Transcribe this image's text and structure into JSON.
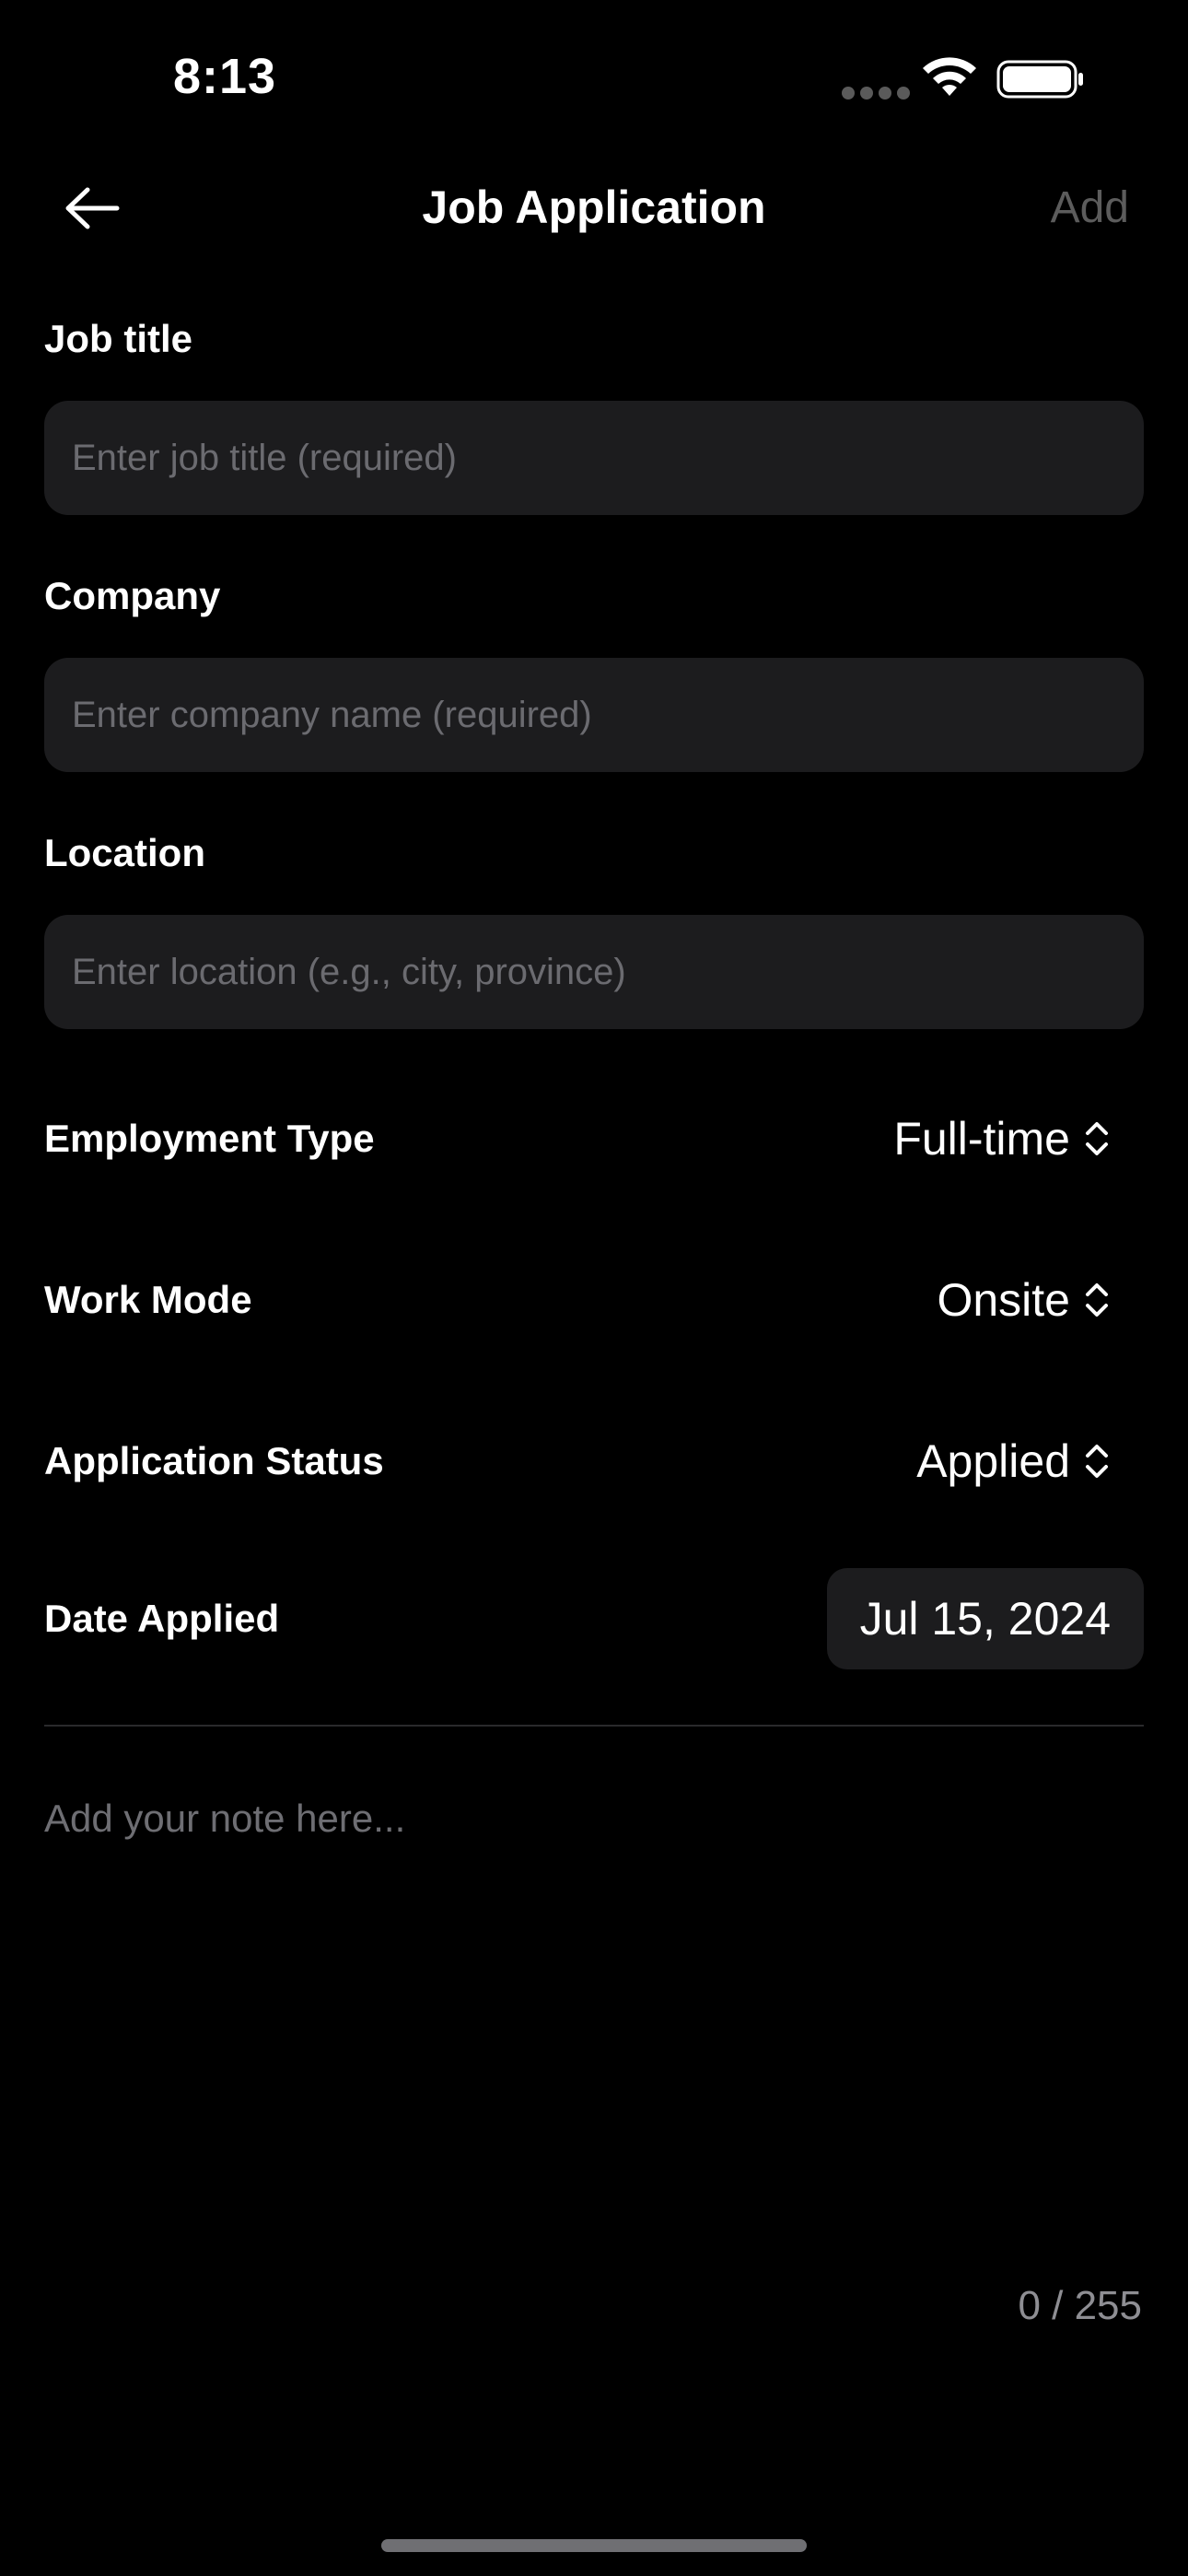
{
  "status_bar": {
    "time": "8:13"
  },
  "nav": {
    "title": "Job Application",
    "add_label": "Add"
  },
  "form": {
    "job_title": {
      "label": "Job title",
      "placeholder": "Enter job title (required)",
      "value": ""
    },
    "company": {
      "label": "Company",
      "placeholder": "Enter company name (required)",
      "value": ""
    },
    "location": {
      "label": "Location",
      "placeholder": "Enter location (e.g., city, province)",
      "value": ""
    },
    "employment_type": {
      "label": "Employment Type",
      "value": "Full-time"
    },
    "work_mode": {
      "label": "Work Mode",
      "value": "Onsite"
    },
    "application_status": {
      "label": "Application Status",
      "value": "Applied"
    },
    "date_applied": {
      "label": "Date Applied",
      "value": "Jul 15, 2024"
    },
    "note": {
      "placeholder": "Add your note here...",
      "value": "",
      "counter": "0 / 255"
    }
  },
  "icons": {
    "back": "arrow-left-icon",
    "picker": "chevron-up-down-icon",
    "wifi": "wifi-icon",
    "battery": "battery-icon"
  },
  "colors": {
    "background": "#000000",
    "field_background": "#1c1c1e",
    "disabled_text": "#5c5c5c",
    "placeholder": "#6b6b70"
  }
}
